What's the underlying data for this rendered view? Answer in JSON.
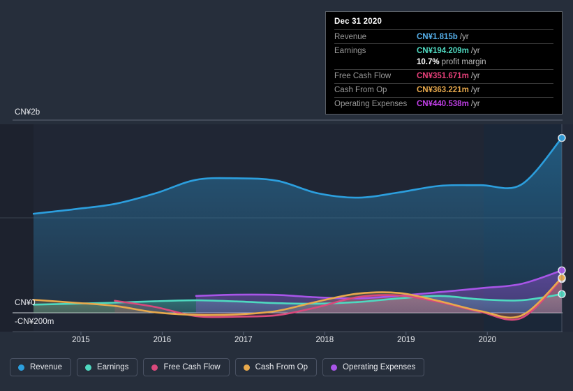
{
  "chart_data": {
    "type": "line",
    "title": "",
    "xlabel": "",
    "ylabel": "",
    "currency": "CN¥",
    "x_ticks": [
      "2015",
      "2016",
      "2017",
      "2018",
      "2019",
      "2020"
    ],
    "y_ticks": [
      "CN¥2b",
      "CN¥0",
      "-CN¥200m"
    ],
    "y_tick_values": [
      2000,
      0,
      -200
    ],
    "ylim": [
      -200,
      2200
    ],
    "grid": true,
    "legend_position": "bottom",
    "units": "millions CN¥",
    "x_range": [
      "2014-06",
      "2020-12"
    ],
    "series": [
      {
        "name": "Revenue",
        "color": "#2C9FDE",
        "x": [
          "2014-06",
          "2014-12",
          "2015-06",
          "2015-12",
          "2016-06",
          "2016-12",
          "2017-06",
          "2017-12",
          "2018-06",
          "2018-12",
          "2019-06",
          "2019-12",
          "2020-06",
          "2020-12"
        ],
        "values": [
          1028,
          1075,
          1130,
          1240,
          1380,
          1396,
          1370,
          1240,
          1195,
          1250,
          1318,
          1325,
          1330,
          1815
        ]
      },
      {
        "name": "Earnings",
        "color": "#4FD9C0",
        "x": [
          "2014-06",
          "2014-12",
          "2015-06",
          "2015-12",
          "2016-06",
          "2016-12",
          "2017-06",
          "2017-12",
          "2018-06",
          "2018-12",
          "2019-06",
          "2019-12",
          "2020-06",
          "2020-12"
        ],
        "values": [
          85,
          95,
          105,
          120,
          130,
          118,
          100,
          95,
          112,
          150,
          175,
          140,
          130,
          194.209
        ]
      },
      {
        "name": "Free Cash Flow",
        "color": "#D9497C",
        "x": [
          "2015-06",
          "2015-12",
          "2016-06",
          "2016-12",
          "2017-06",
          "2017-12",
          "2018-06",
          "2018-12",
          "2019-06",
          "2019-12",
          "2020-06",
          "2020-12"
        ],
        "values": [
          125,
          60,
          -35,
          -40,
          -25,
          60,
          165,
          180,
          110,
          10,
          -55,
          351.671
        ]
      },
      {
        "name": "Cash From Op",
        "color": "#E8A94C",
        "x": [
          "2014-06",
          "2014-12",
          "2015-06",
          "2015-12",
          "2016-06",
          "2016-12",
          "2017-06",
          "2017-12",
          "2018-06",
          "2018-12",
          "2019-06",
          "2019-12",
          "2020-06",
          "2020-12"
        ],
        "values": [
          135,
          105,
          72,
          5,
          -22,
          -18,
          20,
          118,
          200,
          205,
          120,
          18,
          -30,
          363.221
        ]
      },
      {
        "name": "Operating Expenses",
        "color": "#A855E8",
        "x": [
          "2016-06",
          "2016-12",
          "2017-06",
          "2017-12",
          "2018-06",
          "2018-12",
          "2019-06",
          "2019-12",
          "2020-06",
          "2020-12"
        ],
        "values": [
          175,
          188,
          185,
          160,
          150,
          178,
          215,
          255,
          300,
          440.538
        ]
      }
    ]
  },
  "tooltip": {
    "title": "Dec 31 2020",
    "rows": [
      {
        "name": "Revenue",
        "value": "CN¥1.815b",
        "suffix": "/yr",
        "color": "#55AEE8"
      },
      {
        "name": "Earnings",
        "value": "CN¥194.209m",
        "suffix": "/yr",
        "color": "#4FD9C0"
      },
      {
        "name": "",
        "value": "10.7%",
        "suffix": "profit margin",
        "color": "#FFFFFF"
      },
      {
        "name": "Free Cash Flow",
        "value": "CN¥351.671m",
        "suffix": "/yr",
        "color": "#E8407A"
      },
      {
        "name": "Cash From Op",
        "value": "CN¥363.221m",
        "suffix": "/yr",
        "color": "#E8A94C"
      },
      {
        "name": "Operating Expenses",
        "value": "CN¥440.538m",
        "suffix": "/yr",
        "color": "#C13FE8"
      }
    ]
  },
  "legend": {
    "items": [
      {
        "label": "Revenue",
        "color": "#2C9FDE"
      },
      {
        "label": "Earnings",
        "color": "#4FD9C0"
      },
      {
        "label": "Free Cash Flow",
        "color": "#D9497C"
      },
      {
        "label": "Cash From Op",
        "color": "#E8A94C"
      },
      {
        "label": "Operating Expenses",
        "color": "#A855E8"
      }
    ]
  },
  "axes": {
    "y_labels": [
      {
        "text": "CN¥2b",
        "pos": "top"
      },
      {
        "text": "CN¥0",
        "pos": "zero"
      },
      {
        "text": "-CN¥200m",
        "pos": "neg"
      }
    ],
    "x_labels": [
      "2015",
      "2016",
      "2017",
      "2018",
      "2019",
      "2020"
    ]
  }
}
